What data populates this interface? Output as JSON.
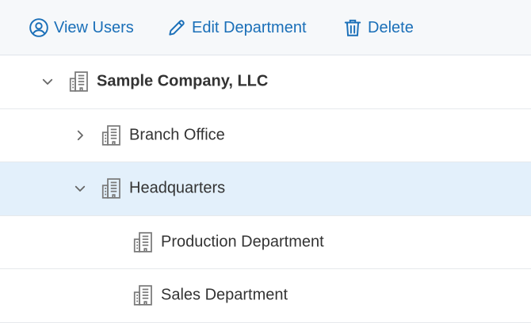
{
  "toolbar": {
    "view_users_label": "View Users",
    "edit_department_label": "Edit Department",
    "delete_label": "Delete",
    "accent_color": "#1a6fb8"
  },
  "tree": {
    "nodes": [
      {
        "label": "Sample Company, LLC",
        "level": 0,
        "expanded": true,
        "bold": true
      },
      {
        "label": "Branch Office",
        "level": 1,
        "expanded": false
      },
      {
        "label": "Headquarters",
        "level": 1,
        "expanded": true,
        "selected": true
      },
      {
        "label": "Production Department",
        "level": 2
      },
      {
        "label": "Sales Department",
        "level": 2
      }
    ],
    "selected_color": "#e3f0fb"
  }
}
